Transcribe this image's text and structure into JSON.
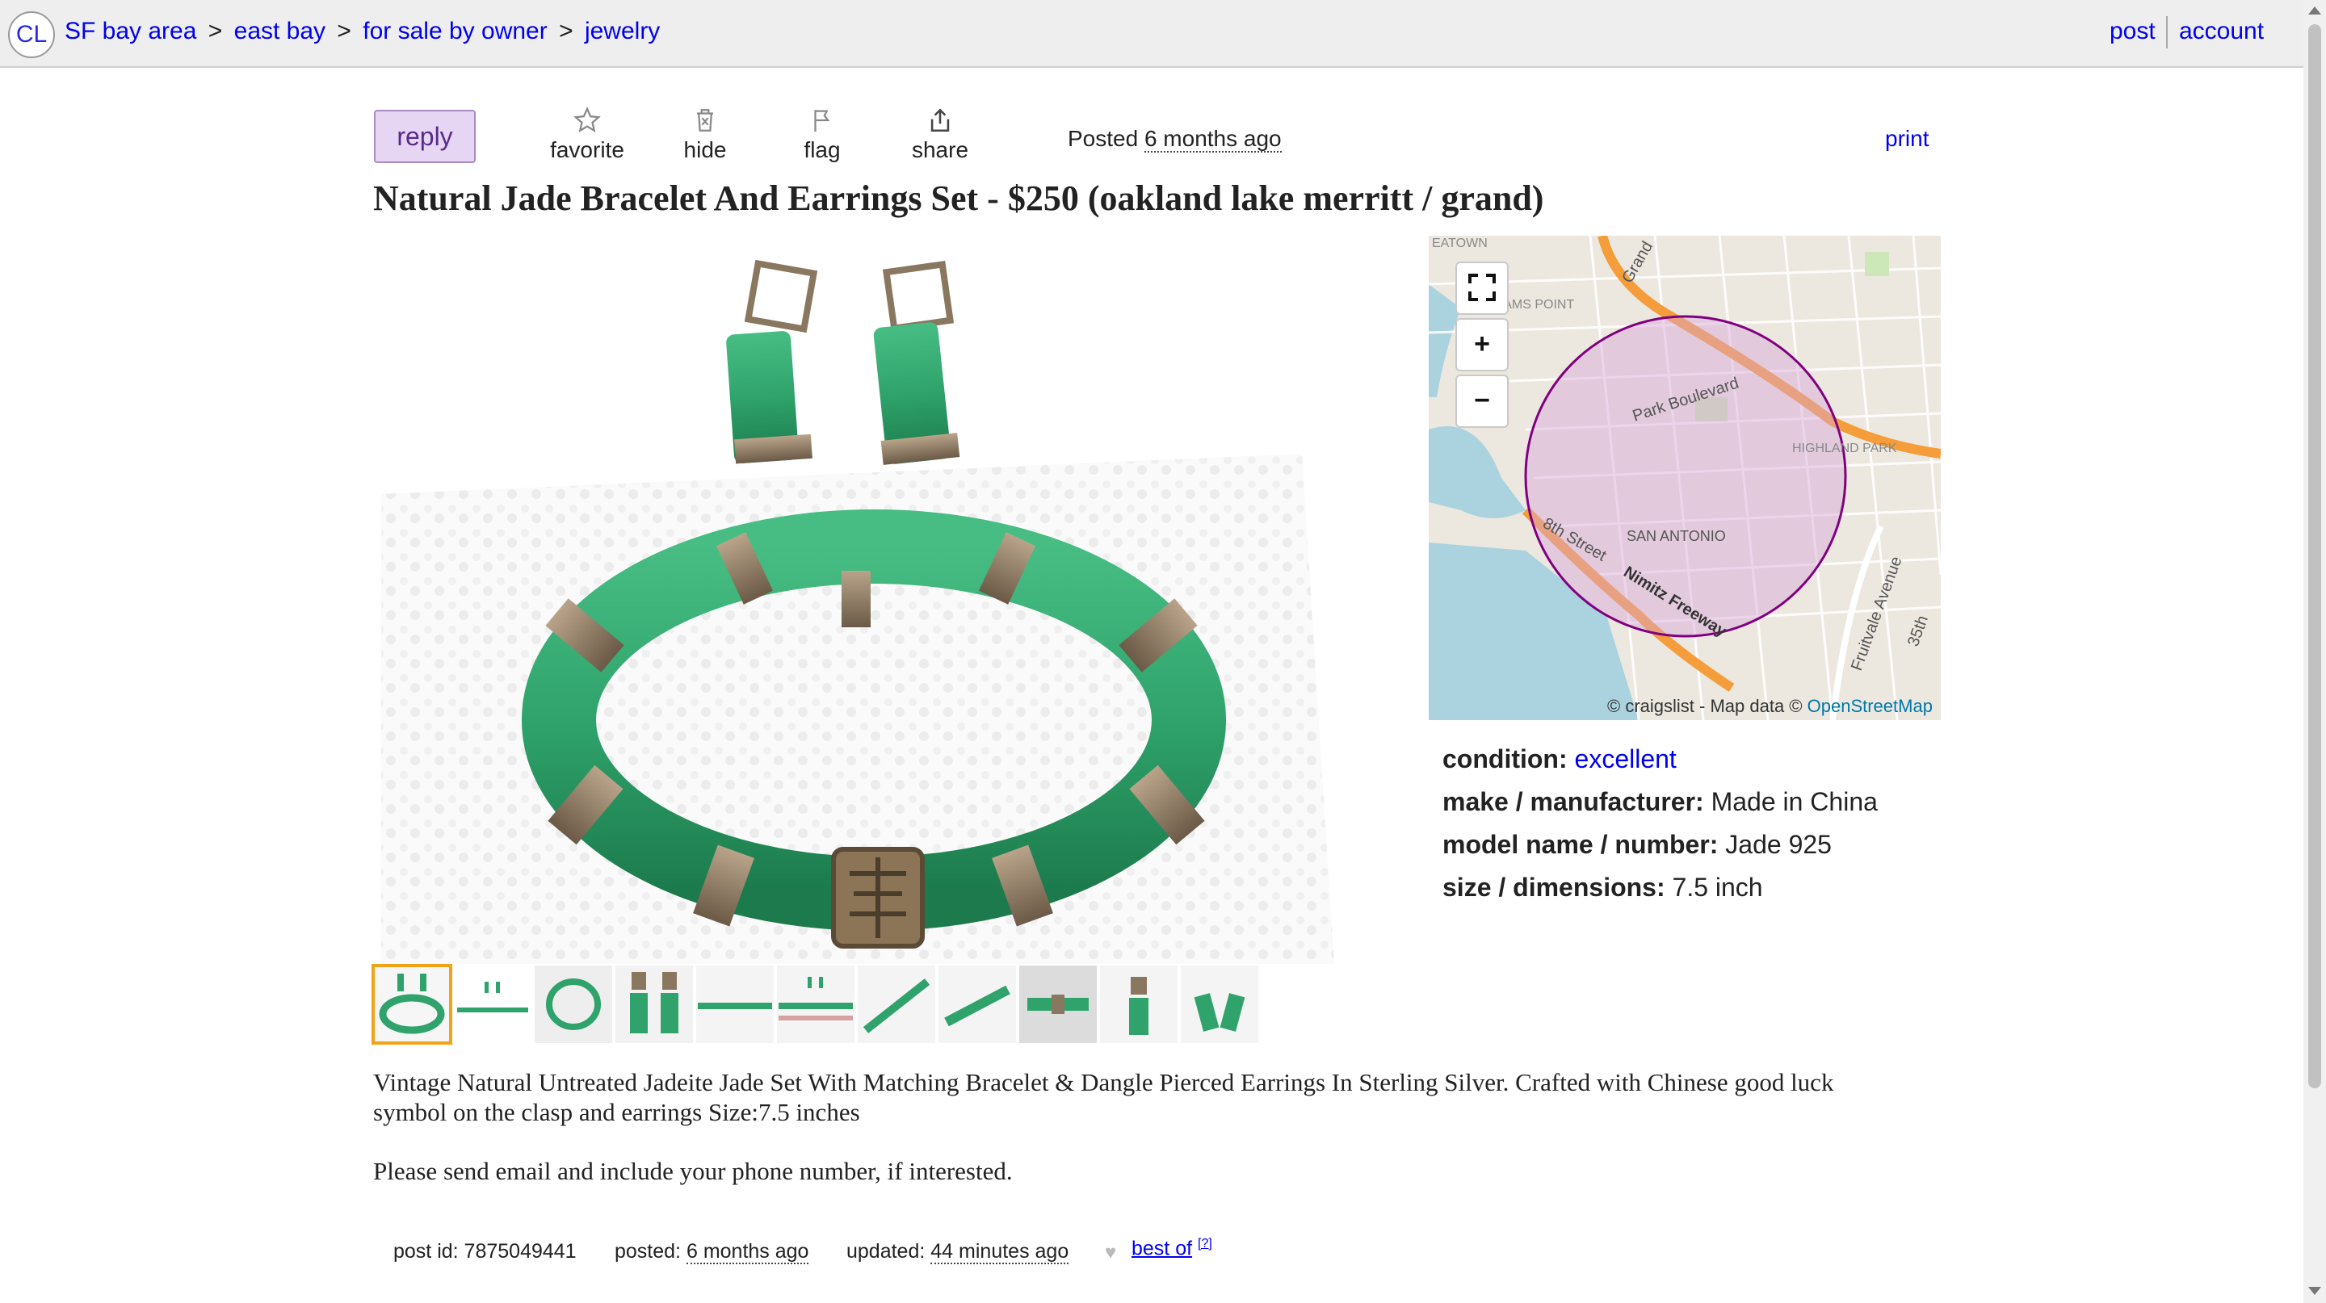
{
  "header": {
    "logo": "CL",
    "breadcrumbs": [
      "SF bay area",
      "east bay",
      "for sale by owner",
      "jewelry"
    ],
    "separator": ">",
    "post_link": "post",
    "account_link": "account"
  },
  "actions": {
    "reply": "reply",
    "favorite": "favorite",
    "hide": "hide",
    "flag": "flag",
    "share": "share",
    "posted_prefix": "Posted",
    "posted_time": "6 months ago",
    "print": "print"
  },
  "listing": {
    "title": "Natural Jade Bracelet And Earrings Set - $250 (oakland lake merritt / grand)",
    "image_count": 11,
    "active_thumb": 0
  },
  "map": {
    "labels": [
      "Park Boulevard",
      "SAN ANTONIO",
      "8th Street",
      "Nimitz Freeway",
      "HIGHLAND PARK",
      "ADAMS POINT",
      "Grand",
      "Fruitvale Avenue",
      "35th",
      "EATOWN"
    ],
    "attribution_prefix": "© craigslist - Map data ©",
    "attribution_link": "OpenStreetMap",
    "fullscreen_icon": "fullscreen-icon",
    "zoom_in": "+",
    "zoom_out": "−"
  },
  "attributes": [
    {
      "label": "condition:",
      "value": "excellent",
      "is_link": true
    },
    {
      "label": "make / manufacturer:",
      "value": "Made in China",
      "is_link": false
    },
    {
      "label": "model name / number:",
      "value": "Jade 925",
      "is_link": false
    },
    {
      "label": "size / dimensions:",
      "value": "7.5 inch",
      "is_link": false
    }
  ],
  "body": {
    "paragraph1": "Vintage Natural Untreated Jadeite Jade Set With Matching Bracelet & Dangle Pierced Earrings In Sterling Silver. Crafted with Chinese good luck symbol on the clasp and earrings Size:7.5 inches",
    "paragraph2": "Please send email and include your phone number, if interested."
  },
  "postinfo": {
    "post_id_label": "post id: 7875049441",
    "posted_label": "posted:",
    "posted_value": "6 months ago",
    "updated_label": "updated:",
    "updated_value": "44 minutes ago",
    "best_of": "best of",
    "best_of_help": "[?]"
  },
  "colors": {
    "link": "#0000ee",
    "reply_bg": "#e6d6f4",
    "jade": "#2fa36b",
    "thumb_active": "#f0a318",
    "map_circle": "#800080"
  }
}
